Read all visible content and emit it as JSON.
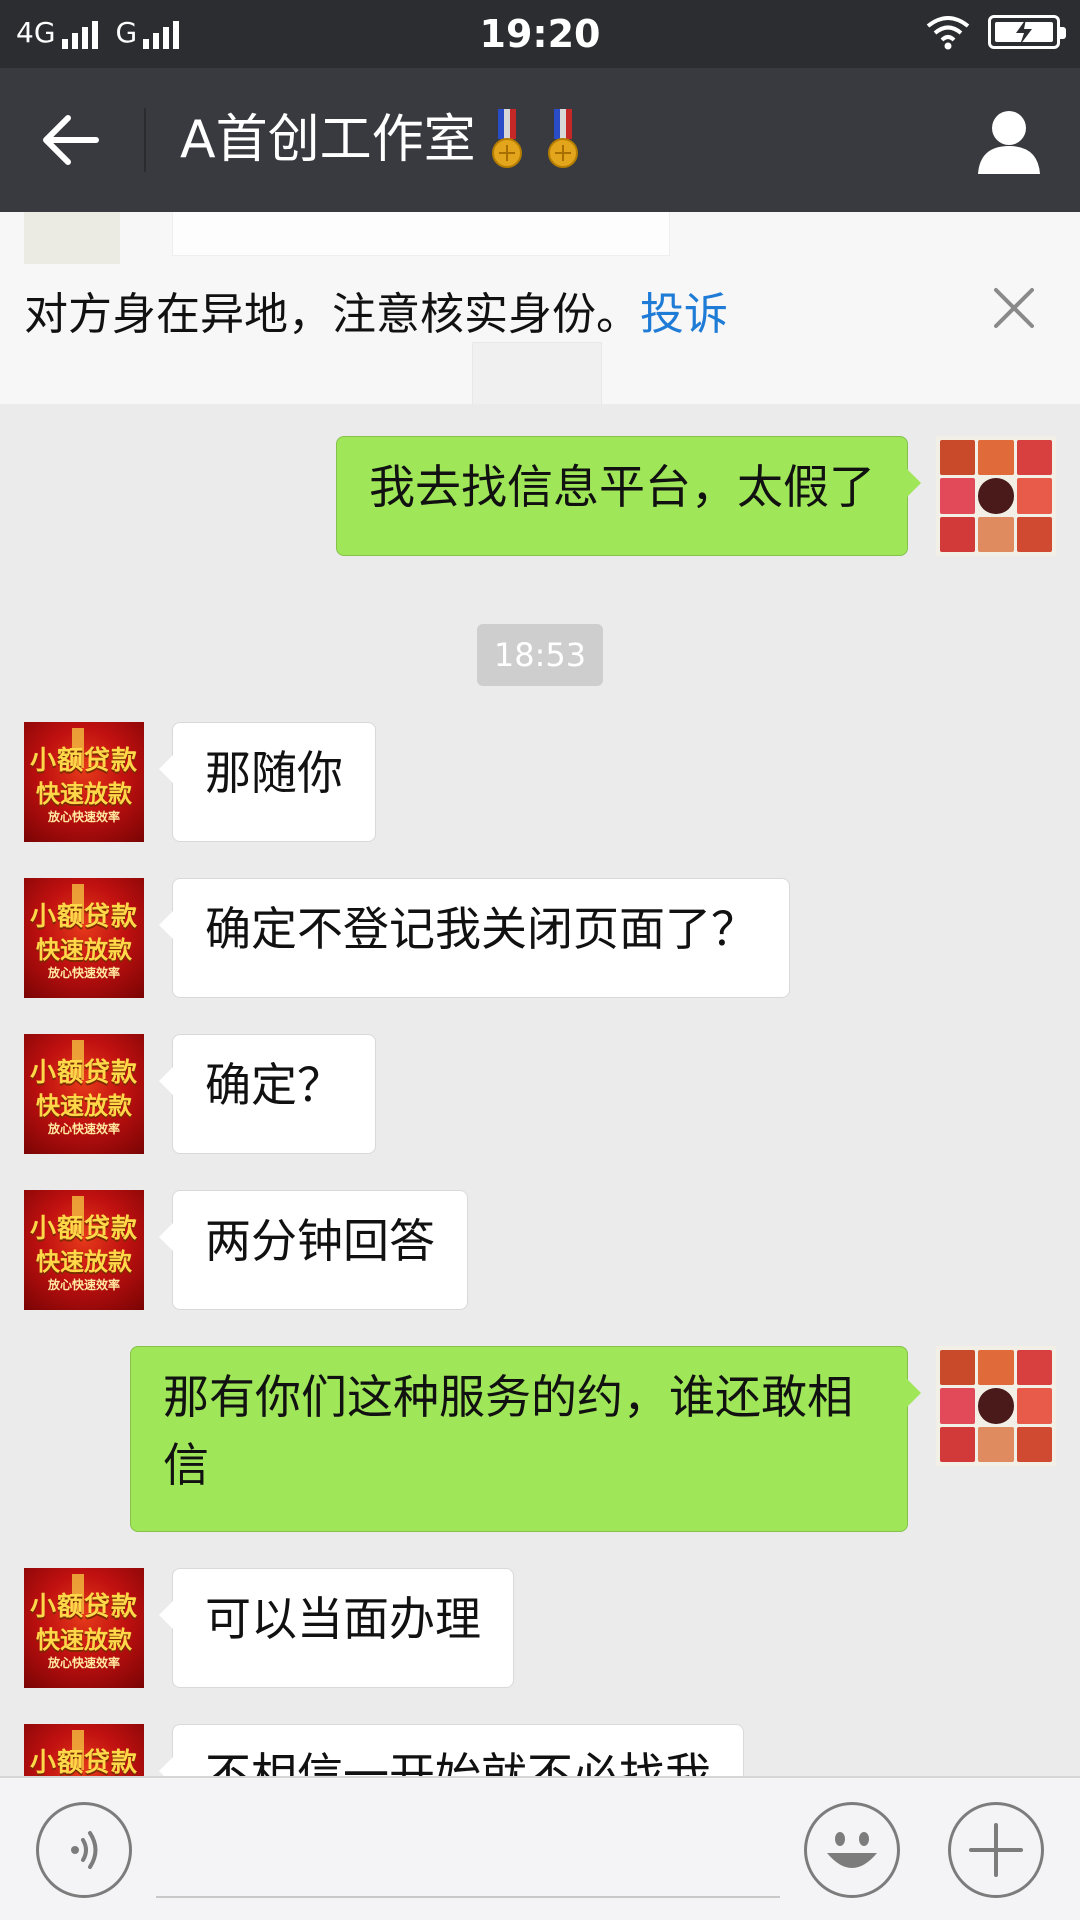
{
  "status_bar": {
    "network1": "4G",
    "network2": "G",
    "time": "19:20"
  },
  "header": {
    "title": "A首创工作室"
  },
  "banner": {
    "text": "对方身在异地，注意核实身份。",
    "link": "投诉"
  },
  "messages": [
    {
      "side": "out",
      "text": "我去找信息平台，太假了"
    },
    {
      "type": "timestamp",
      "text": "18:53"
    },
    {
      "side": "in",
      "text": "那随你"
    },
    {
      "side": "in",
      "text": "确定不登记我关闭页面了？"
    },
    {
      "side": "in",
      "text": "确定？"
    },
    {
      "side": "in",
      "text": "两分钟回答"
    },
    {
      "side": "out",
      "text": "那有你们这种服务的约，谁还敢相信"
    },
    {
      "side": "in",
      "text": "可以当面办理"
    },
    {
      "side": "in",
      "text": "不相信一开始就不必找我"
    }
  ],
  "avatar_text": {
    "line1": "小额贷款",
    "line2": "快速放款",
    "line3": "放心快速效率"
  },
  "colors": {
    "header_bg": "#393a3f",
    "status_bg": "#2b2d30",
    "chat_bg": "#ebebeb",
    "outgoing_bubble": "#9fe658",
    "incoming_bubble": "#ffffff",
    "link": "#1e7bd6"
  },
  "icons": {
    "back": "arrow-left-icon",
    "profile": "person-icon",
    "close": "close-icon",
    "voice": "voice-icon",
    "emoji": "smiley-icon",
    "plus": "plus-icon",
    "wifi": "wifi-icon",
    "battery": "battery-charging-icon",
    "medal": "medal-icon"
  }
}
